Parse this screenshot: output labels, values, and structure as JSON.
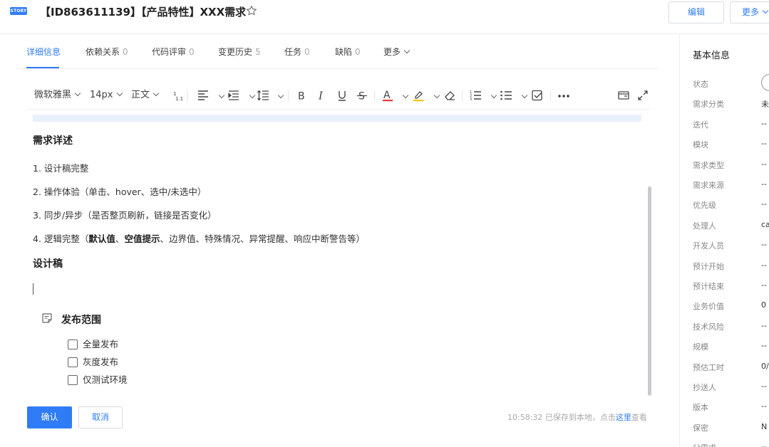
{
  "header": {
    "badge": "STORY",
    "title": "【ID863611139】【产品特性】XXX需求",
    "edit_label": "编辑",
    "more_label": "更多"
  },
  "tabs": [
    {
      "label": "详细信息",
      "count": ""
    },
    {
      "label": "依赖关系",
      "count": "0"
    },
    {
      "label": "代码评审",
      "count": "0"
    },
    {
      "label": "变更历史",
      "count": "5"
    },
    {
      "label": "任务",
      "count": "0"
    },
    {
      "label": "缺陷",
      "count": "0"
    },
    {
      "label": "更多",
      "count": ""
    }
  ],
  "toolbar": {
    "font_family": "微软雅黑",
    "font_size": "14px",
    "paragraph": "正文"
  },
  "content": {
    "heading1": "需求详述",
    "items": [
      "1. 设计稿完整",
      "2. 操作体验（单击、hover、选中/未选中）",
      "3. 同步/异步（是否整页刷新，链接是否变化）"
    ],
    "item4_prefix": "4. 逻辑完整（",
    "item4_bold1": "默认值",
    "item4_sep": "、",
    "item4_bold2": "空值提示",
    "item4_suffix": "、边界值、特殊情况、异常提醒、响应中断警告等）",
    "heading2": "设计稿",
    "note_title": "发布范围",
    "checkboxes": [
      "全量发布",
      "灰度发布",
      "仅测试环境"
    ]
  },
  "footer": {
    "confirm_label": "确认",
    "cancel_label": "取消",
    "save_time": "10:58:32",
    "save_text": "已保存到本地，点击",
    "save_link": "这里",
    "save_suffix": "查看"
  },
  "right_panel": {
    "title": "基本信息",
    "fields": [
      {
        "label": "状态",
        "value": ""
      },
      {
        "label": "需求分类",
        "value": "未"
      },
      {
        "label": "迭代",
        "value": "--"
      },
      {
        "label": "模块",
        "value": "--"
      },
      {
        "label": "需求类型",
        "value": "--"
      },
      {
        "label": "需求来源",
        "value": "--"
      },
      {
        "label": "优先级",
        "value": "--"
      },
      {
        "label": "处理人",
        "value": "ca"
      },
      {
        "label": "开发人员",
        "value": "--"
      },
      {
        "label": "预计开始",
        "value": "--"
      },
      {
        "label": "预计结束",
        "value": "--"
      },
      {
        "label": "业务价值",
        "value": "0"
      },
      {
        "label": "技术风险",
        "value": "--"
      },
      {
        "label": "规模",
        "value": "--"
      },
      {
        "label": "预估工时",
        "value": "0/"
      },
      {
        "label": "抄送人",
        "value": "--"
      },
      {
        "label": "版本",
        "value": "--"
      },
      {
        "label": "保密",
        "value": "N"
      },
      {
        "label": "父需求",
        "value": "--"
      }
    ]
  },
  "colors": {
    "accent": "#2f7cf6",
    "font_color_underline": "#e53935",
    "highlight_underline": "#f5c400"
  }
}
